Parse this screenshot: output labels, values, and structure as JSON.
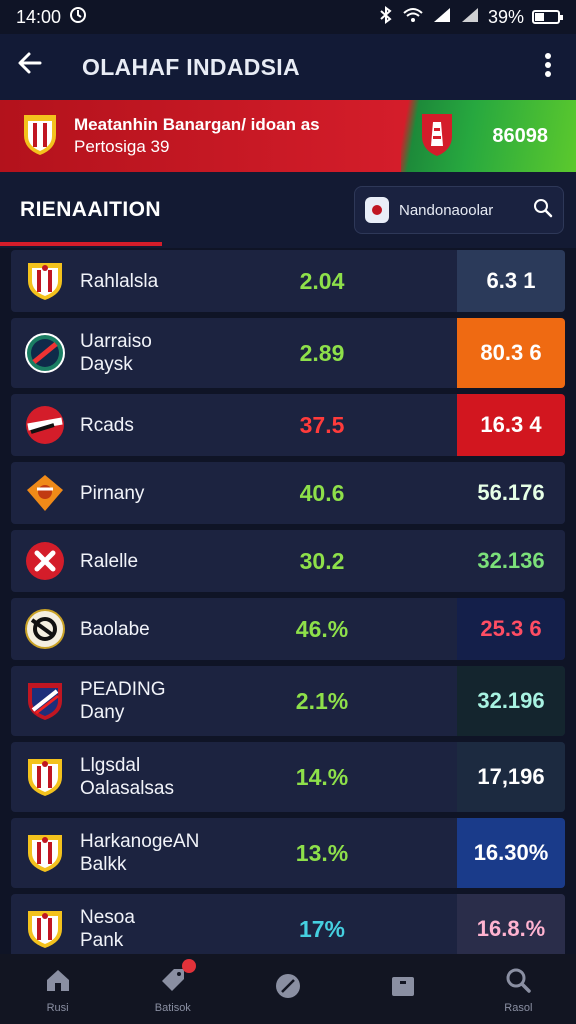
{
  "status_bar": {
    "time": "14:00",
    "battery": "39%",
    "battery_level": 0.39
  },
  "app_bar": {
    "title": "OLAHAF INDADSIA"
  },
  "banner": {
    "line1": "Meatanhin Banargan/ idoan as",
    "line2": "Pertosiga 39",
    "value": "86098"
  },
  "tab": {
    "label": "RIENAAITION"
  },
  "search": {
    "placeholder": "Nandonaoolar"
  },
  "colors": {
    "accent_red": "#d41d2a",
    "accent_green": "#5cc92d",
    "background": "#0f1426",
    "row": "#1c2340"
  },
  "rows": [
    {
      "name_line1": "Rahlalsla",
      "name_line2": "",
      "pct": "2.04",
      "pct_color": "#8ee04a",
      "value": "6.3 1",
      "value_bg": "#2b3a5a",
      "value_color": "#ffffff",
      "logo": "shield-red-white"
    },
    {
      "name_line1": "Uarraiso",
      "name_line2": "Daysk",
      "pct": "2.89",
      "pct_color": "#8ee04a",
      "value": "80.3 6",
      "value_bg": "#ef6a12",
      "value_color": "#ffffff",
      "logo": "round-green-crest"
    },
    {
      "name_line1": "Rcads",
      "name_line2": "",
      "pct": "37.5",
      "pct_color": "#ff3b3b",
      "value": "16.3 4",
      "value_bg": "#d2161f",
      "value_color": "#ffffff",
      "logo": "round-red-stripe"
    },
    {
      "name_line1": "Pirnany",
      "name_line2": "",
      "pct": "40.6",
      "pct_color": "#8ee04a",
      "value": "56.176",
      "value_bg": "#1c2340",
      "value_color": "#e6ffe6",
      "logo": "orange-diamond"
    },
    {
      "name_line1": "Ralelle",
      "name_line2": "",
      "pct": "30.2",
      "pct_color": "#8ee04a",
      "value": "32.136",
      "value_bg": "#1c2340",
      "value_color": "#7be07a",
      "logo": "red-round-x"
    },
    {
      "name_line1": "Baolabe",
      "name_line2": "",
      "pct": "46.%",
      "pct_color": "#8ee04a",
      "value": "25.3 6",
      "value_bg": "#141f4a",
      "value_color": "#ff4d63",
      "logo": "white-round-black"
    },
    {
      "name_line1": "PEADING",
      "name_line2": "Dany",
      "pct": "2.1%",
      "pct_color": "#8ee04a",
      "value": "32.196",
      "value_bg": "#14252e",
      "value_color": "#a8f3e2",
      "logo": "shield-blue-red"
    },
    {
      "name_line1": "Llgsdal",
      "name_line2": "Oalasalsas",
      "pct": "14.%",
      "pct_color": "#8ee04a",
      "value": "17,196",
      "value_bg": "#1c2a40",
      "value_color": "#ffffff",
      "logo": "shield-red-white"
    },
    {
      "name_line1": "HarkanogeAN",
      "name_line2": "Balkk",
      "pct": "13.%",
      "pct_color": "#8ee04a",
      "value": "16.30%",
      "value_bg": "#1a3b8a",
      "value_color": "#ffffff",
      "logo": "shield-red-white"
    },
    {
      "name_line1": "Nesoa",
      "name_line2": "Pank",
      "pct": "17%",
      "pct_color": "#45d0e0",
      "value": "16.8.%",
      "value_bg": "#2a2d4a",
      "value_color": "#ffb3d0",
      "logo": "shield-red-white"
    }
  ],
  "bottom_nav": [
    {
      "label": "Rusi",
      "icon": "home-icon"
    },
    {
      "label": "Batisok",
      "icon": "tag-icon",
      "badge": true
    },
    {
      "label": "",
      "icon": "leaf-icon"
    },
    {
      "label": "",
      "icon": "box-icon"
    },
    {
      "label": "Rasol",
      "icon": "search-icon"
    }
  ]
}
